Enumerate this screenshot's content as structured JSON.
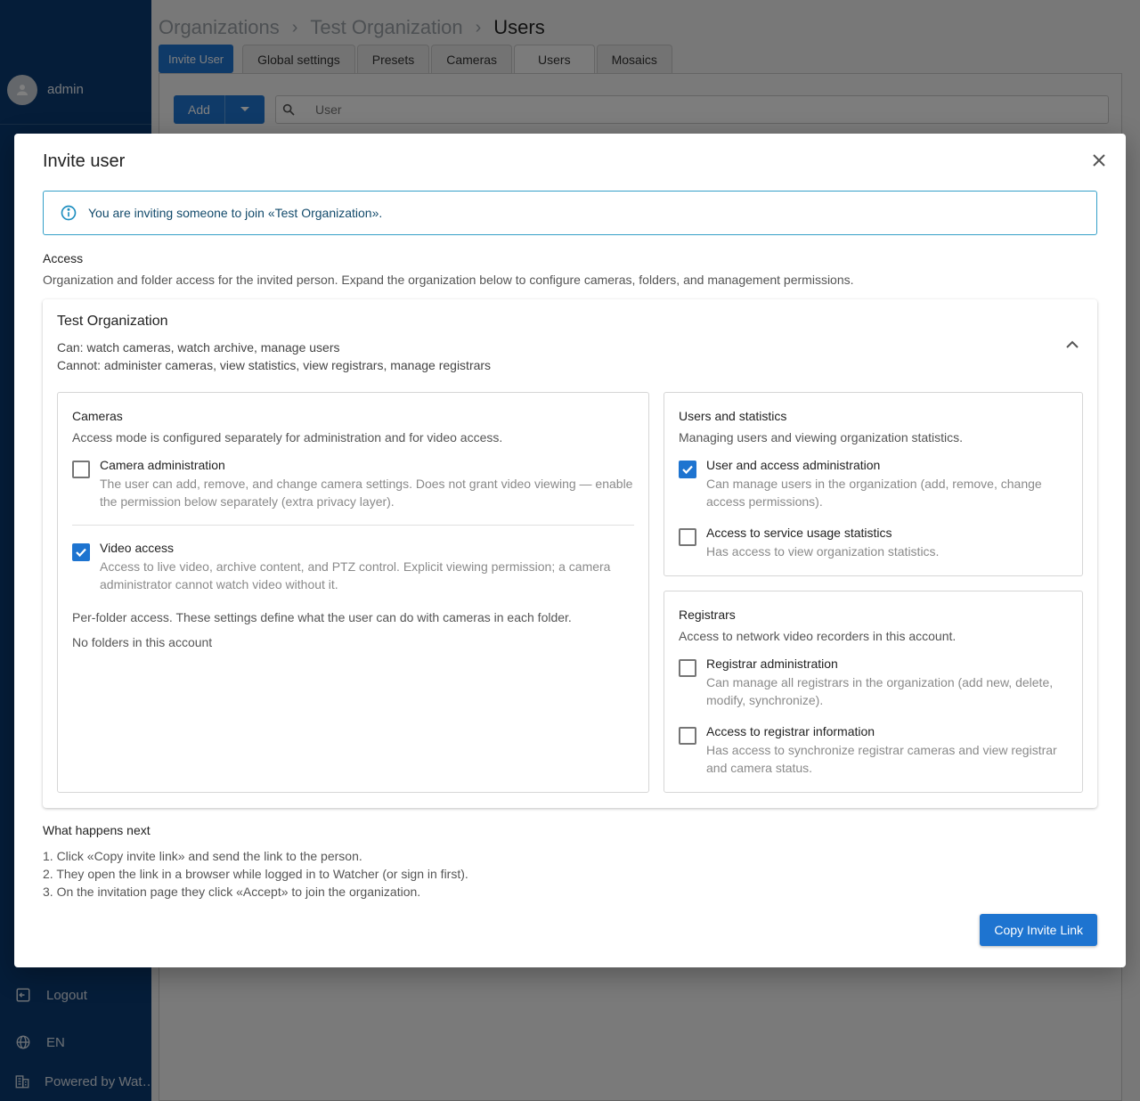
{
  "sidebar": {
    "user_name": "admin",
    "logout_label": "Logout",
    "language_label": "EN",
    "powered_label": "Powered by Wat…"
  },
  "header": {
    "breadcrumb": [
      "Organizations",
      "Test Organization",
      "Users"
    ],
    "tabs": {
      "invite_user": "Invite User",
      "global_settings": "Global settings",
      "presets": "Presets",
      "cameras": "Cameras",
      "users": "Users",
      "mosaics": "Mosaics"
    }
  },
  "toolbar": {
    "add_label": "Add",
    "search_placeholder": "User"
  },
  "modal": {
    "title": "Invite user",
    "info_text": "You are inviting someone to join «Test Organization».",
    "access_heading": "Access",
    "access_description": "Organization and folder access for the invited person. Expand the organization below to configure cameras, folders, and management permissions.",
    "org": {
      "name": "Test Organization",
      "can": "Can: watch cameras, watch archive, manage users",
      "cannot": "Cannot: administer cameras, view statistics, view registrars, manage registrars",
      "expanded": true
    },
    "cameras": {
      "title": "Cameras",
      "description": "Access mode is configured separately for administration and for video access.",
      "camera_admin": {
        "label": "Camera administration",
        "sub": "The user can add, remove, and change camera settings. Does not grant video viewing — enable the permission below separately (extra privacy layer).",
        "checked": false
      },
      "video_access": {
        "label": "Video access",
        "sub": "Access to live video, archive content, and PTZ control. Explicit viewing permission; a camera administrator cannot watch video without it.",
        "checked": true
      },
      "per_folder": "Per-folder access. These settings define what the user can do with cameras in each folder.",
      "no_folders": "No folders in this account"
    },
    "users_stats": {
      "title": "Users and statistics",
      "description": "Managing users and viewing organization statistics.",
      "user_admin": {
        "label": "User and access administration",
        "sub": "Can manage users in the organization (add, remove, change access permissions).",
        "checked": true
      },
      "stats": {
        "label": "Access to service usage statistics",
        "sub": "Has access to view organization statistics.",
        "checked": false
      }
    },
    "registrars": {
      "title": "Registrars",
      "description": "Access to network video recorders in this account.",
      "admin": {
        "label": "Registrar administration",
        "sub": "Can manage all registrars in the organization (add new, delete, modify, synchronize).",
        "checked": false
      },
      "info": {
        "label": "Access to registrar information",
        "sub": "Has access to synchronize registrar cameras and view registrar and camera status.",
        "checked": false
      }
    },
    "next_heading": "What happens next",
    "next_steps": [
      "1. Click «Copy invite link» and send the link to the person.",
      "2. They open the link in a browser while logged in to Watcher (or sign in first).",
      "3. On the invitation page they click «Accept» to join the organization."
    ],
    "copy_button": "Copy Invite Link"
  },
  "colors": {
    "sidebar": "#0b3b73",
    "primary": "#1e74d0",
    "info_border": "#35a0c8"
  }
}
